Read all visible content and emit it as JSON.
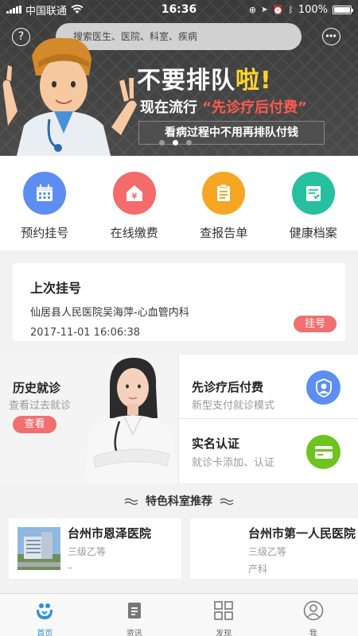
{
  "status_bar": {
    "carrier": "中国联通",
    "time": "16:36",
    "battery": "100%"
  },
  "header": {
    "search_placeholder": "搜索医生、医院、科室、疾病"
  },
  "banner": {
    "line1_a": "不要排队",
    "line1_b": "啦!",
    "line2_a": "现在流行",
    "line2_b": "“先诊疗后付费”",
    "line3": "看病过程中不用再排队付钱",
    "slide_count": 3,
    "active_slide": 2
  },
  "quick_actions": [
    {
      "label": "预约挂号",
      "icon": "calendar-icon",
      "color": "#5b8ef0"
    },
    {
      "label": "在线缴费",
      "icon": "payment-house-icon",
      "color": "#f36b6b"
    },
    {
      "label": "查报告单",
      "icon": "report-icon",
      "color": "#f5a623"
    },
    {
      "label": "健康档案",
      "icon": "health-file-icon",
      "color": "#26c0a0"
    }
  ],
  "last_registration": {
    "title": "上次挂号",
    "hospital_doctor": "仙居县人民医院吴海萍-心血管内科",
    "datetime": "2017-11-01 16:06:38",
    "button": "挂号"
  },
  "history": {
    "title": "历史就诊",
    "subtitle": "查看过去就诊",
    "button": "查看"
  },
  "features": [
    {
      "title": "先诊疗后付费",
      "subtitle": "新型支付就诊模式",
      "icon": "doctor-shield-icon",
      "color": "#5b8ef0"
    },
    {
      "title": "实名认证",
      "subtitle": "就诊卡添加、认证",
      "icon": "card-icon",
      "color": "#6cc41f"
    }
  ],
  "section_title": "特色科室推荐",
  "hospitals": [
    {
      "name": "台州市恩泽医院",
      "level": "三级乙等",
      "dept": "–"
    },
    {
      "name": "台州市第一人民医院",
      "level": "三级乙等",
      "dept": "产科"
    }
  ],
  "tabbar": [
    {
      "label": "首页",
      "icon": "home-icon",
      "active": true
    },
    {
      "label": "资讯",
      "icon": "news-icon",
      "active": false
    },
    {
      "label": "发现",
      "icon": "discover-grid-icon",
      "active": false
    },
    {
      "label": "我",
      "icon": "profile-icon",
      "active": false
    }
  ]
}
